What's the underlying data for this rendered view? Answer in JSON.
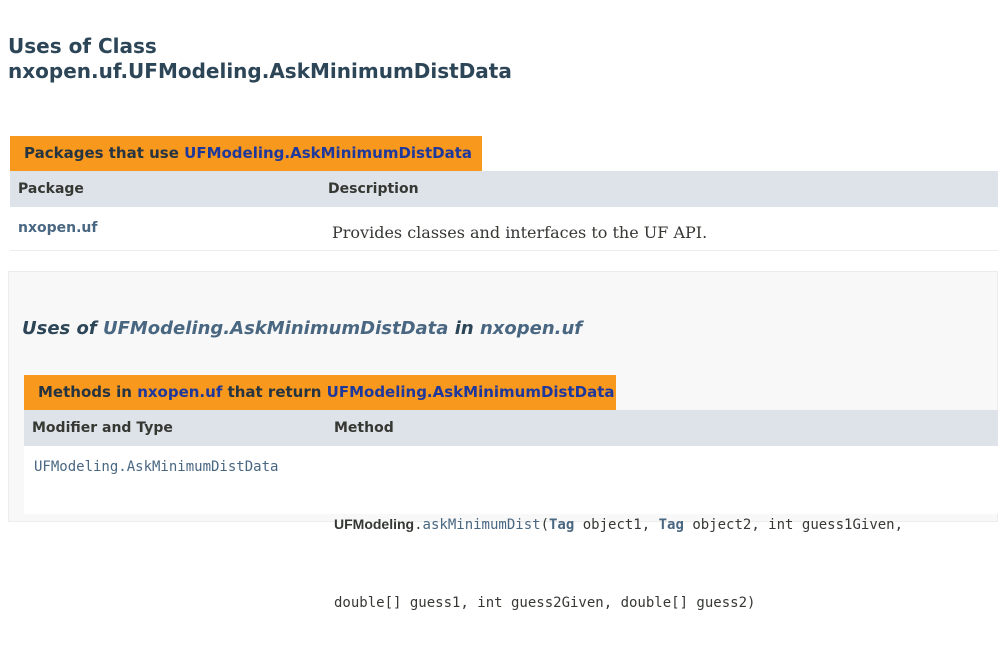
{
  "title": {
    "line1": "Uses of Class",
    "line2": "nxopen.uf.UFModeling.AskMinimumDistData"
  },
  "packages_table": {
    "caption_prefix": "Packages that use ",
    "caption_link": "UFModeling.AskMinimumDistData",
    "headers": {
      "package": "Package",
      "description": "Description"
    },
    "rows": [
      {
        "package": "nxopen.uf",
        "description": "Provides classes and interfaces to the UF API."
      }
    ]
  },
  "uses_section": {
    "prefix": "Uses of ",
    "class_link": "UFModeling.AskMinimumDistData",
    "middle": " in ",
    "package_link": "nxopen.uf"
  },
  "methods_table": {
    "caption_prefix": "Methods in ",
    "caption_package": "nxopen.uf",
    "caption_middle": " that return ",
    "caption_class": "UFModeling.AskMinimumDistData",
    "headers": {
      "modifier": "Modifier and Type",
      "method": "Method"
    },
    "rows": [
      {
        "return_type": "UFModeling.AskMinimumDistData",
        "method_class": "UFModeling",
        "dot": ".",
        "method_name": "askMinimumDist",
        "sig_line1_a": "(",
        "tag1": "Tag",
        "sig_line1_b": " object1, ",
        "tag2": "Tag",
        "sig_line1_c": " object2, int guess1Given,",
        "sig_line2": "double[] guess1, int guess2Given, double[] guess2)"
      }
    ]
  },
  "colors": {
    "caption_bg": "#f8981d",
    "header_bg": "#dee3e9",
    "link": "#4a6782",
    "caption_link": "#1f389c",
    "title": "#2c4557"
  }
}
